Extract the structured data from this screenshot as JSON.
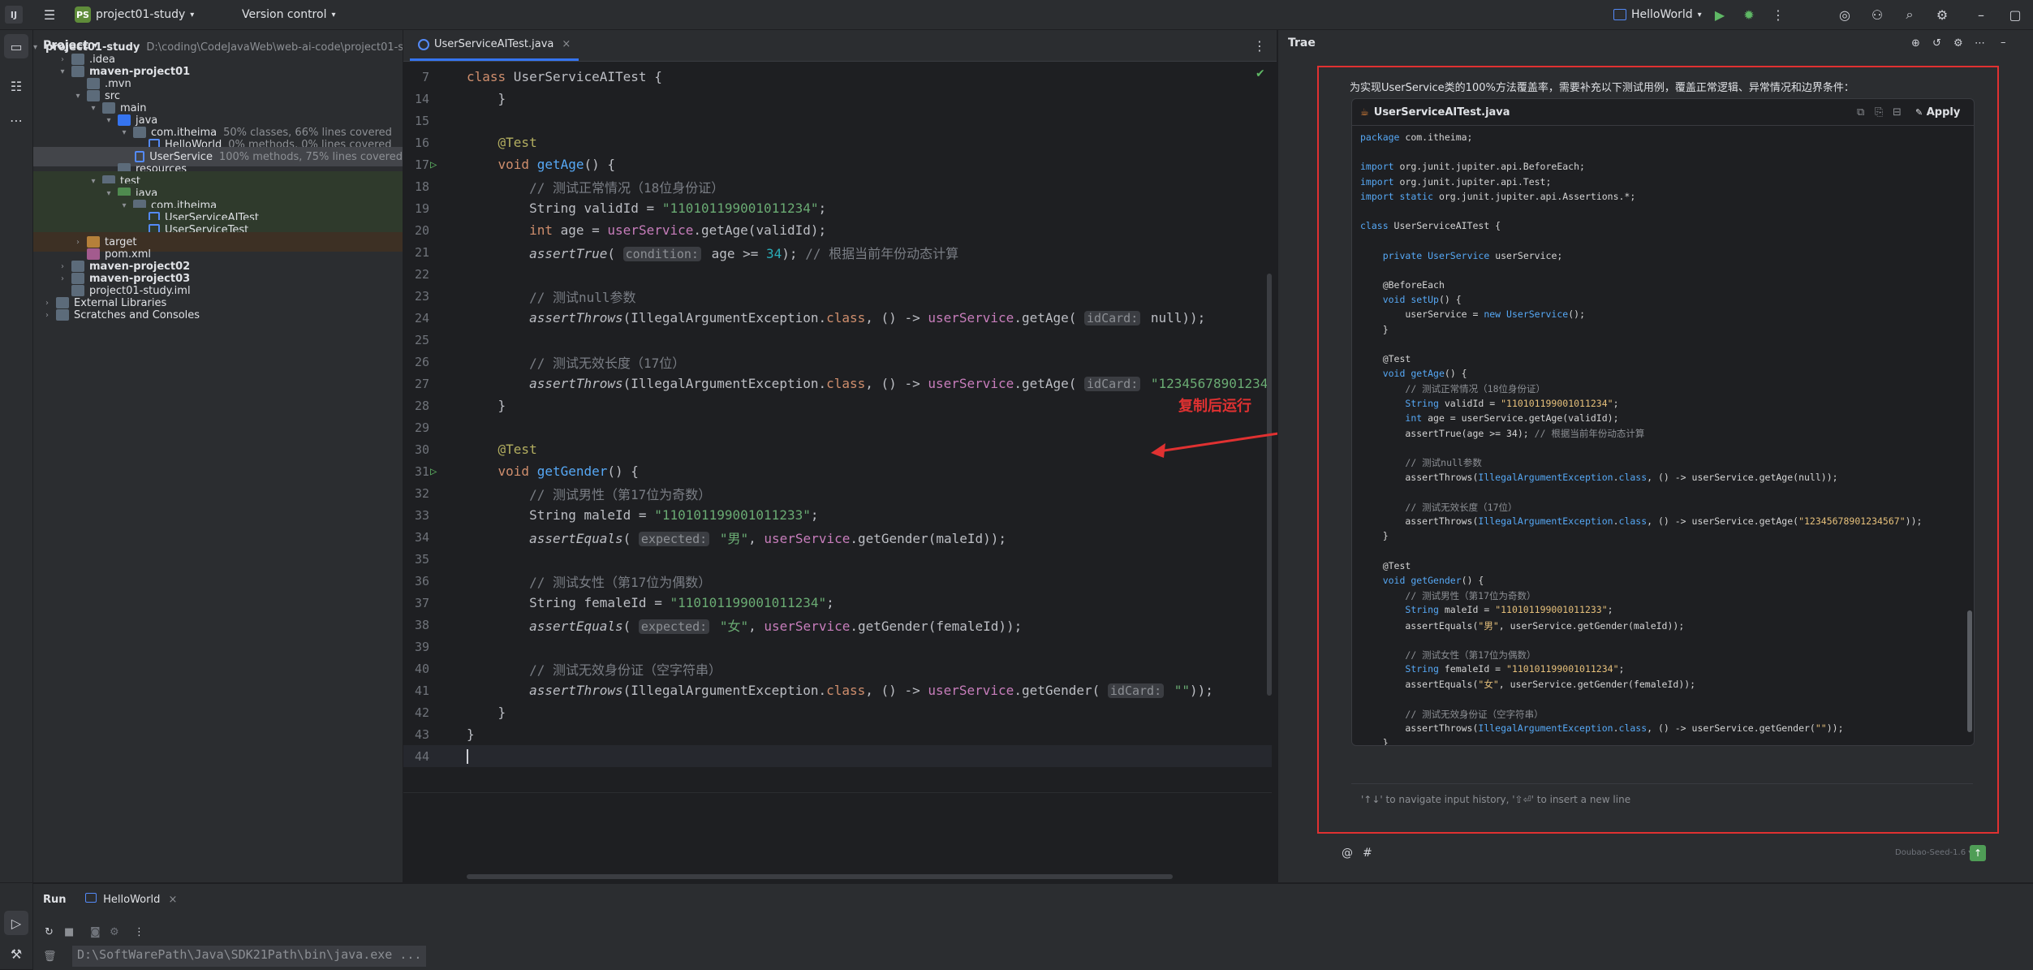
{
  "topbar": {
    "project_badge": "PS",
    "project_name": "project01-study",
    "vcs_label": "Version control",
    "run_config": "HelloWorld"
  },
  "project_panel": {
    "title": "Project",
    "tree": [
      {
        "label": "project01-study",
        "hint": "D:\\coding\\CodeJavaWeb\\web-ai-code\\project01-st",
        "bold": true
      },
      {
        "label": ".idea"
      },
      {
        "label": "maven-project01",
        "bold": true
      },
      {
        "label": ".mvn"
      },
      {
        "label": "src"
      },
      {
        "label": "main"
      },
      {
        "label": "java"
      },
      {
        "label": "com.itheima",
        "hint": "50% classes, 66% lines covered"
      },
      {
        "label": "HelloWorld",
        "hint": "0% methods, 0% lines covered"
      },
      {
        "label": "UserService",
        "hint": "100% methods, 75% lines covered"
      },
      {
        "label": "resources"
      },
      {
        "label": "test"
      },
      {
        "label": "java"
      },
      {
        "label": "com.itheima"
      },
      {
        "label": "UserServiceAITest"
      },
      {
        "label": "UserServiceTest"
      },
      {
        "label": "target"
      },
      {
        "label": "pom.xml"
      },
      {
        "label": "maven-project02",
        "bold": true
      },
      {
        "label": "maven-project03",
        "bold": true
      },
      {
        "label": "project01-study.iml"
      },
      {
        "label": "External Libraries"
      },
      {
        "label": "Scratches and Consoles"
      }
    ]
  },
  "editor": {
    "tab": "UserServiceAITest.java",
    "lines": [
      {
        "n": "7",
        "text": "class UserServiceAITest {"
      },
      {
        "n": "14",
        "text": "    }"
      },
      {
        "n": "15",
        "text": ""
      },
      {
        "n": "16",
        "text": "    @Test"
      },
      {
        "n": "17",
        "text": "    void getAge() {"
      },
      {
        "n": "18",
        "text": "        // 测试正常情况（18位身份证）"
      },
      {
        "n": "19",
        "text": "        String validId = \"110101199001011234\";"
      },
      {
        "n": "20",
        "text": "        int age = userService.getAge(validId);"
      },
      {
        "n": "21",
        "text": "        assertTrue( condition: age >= 34); // 根据当前年份动态计算"
      },
      {
        "n": "22",
        "text": ""
      },
      {
        "n": "23",
        "text": "        // 测试null参数"
      },
      {
        "n": "24",
        "text": "        assertThrows(IllegalArgumentException.class, () -> userService.getAge( idCard: null));"
      },
      {
        "n": "25",
        "text": ""
      },
      {
        "n": "26",
        "text": "        // 测试无效长度（17位）"
      },
      {
        "n": "27",
        "text": "        assertThrows(IllegalArgumentException.class, () -> userService.getAge( idCard: \"12345678901234"
      },
      {
        "n": "28",
        "text": "    }"
      },
      {
        "n": "29",
        "text": ""
      },
      {
        "n": "30",
        "text": "    @Test"
      },
      {
        "n": "31",
        "text": "    void getGender() {"
      },
      {
        "n": "32",
        "text": "        // 测试男性（第17位为奇数）"
      },
      {
        "n": "33",
        "text": "        String maleId = \"110101199001011233\";"
      },
      {
        "n": "34",
        "text": "        assertEquals( expected: \"男\", userService.getGender(maleId));"
      },
      {
        "n": "35",
        "text": ""
      },
      {
        "n": "36",
        "text": "        // 测试女性（第17位为偶数）"
      },
      {
        "n": "37",
        "text": "        String femaleId = \"110101199001011234\";"
      },
      {
        "n": "38",
        "text": "        assertEquals( expected: \"女\", userService.getGender(femaleId));"
      },
      {
        "n": "39",
        "text": ""
      },
      {
        "n": "40",
        "text": "        // 测试无效身份证（空字符串）"
      },
      {
        "n": "41",
        "text": "        assertThrows(IllegalArgumentException.class, () -> userService.getGender( idCard: \"\"));"
      },
      {
        "n": "42",
        "text": "    }"
      },
      {
        "n": "43",
        "text": "}"
      },
      {
        "n": "44",
        "text": ""
      }
    ]
  },
  "trae": {
    "title": "Trae",
    "message": "为实现UserService类的100%方法覆盖率，需要补充以下测试用例，覆盖正常逻辑、异常情况和边界条件：",
    "card_file": "UserServiceAITest.java",
    "apply_label": "Apply",
    "code": [
      "package com.itheima;",
      "",
      "import org.junit.jupiter.api.BeforeEach;",
      "import org.junit.jupiter.api.Test;",
      "import static org.junit.jupiter.api.Assertions.*;",
      "",
      "class UserServiceAITest {",
      "",
      "    private UserService userService;",
      "",
      "    @BeforeEach",
      "    void setUp() {",
      "        userService = new UserService();",
      "    }",
      "",
      "    @Test",
      "    void getAge() {",
      "        // 测试正常情况（18位身份证）",
      "        String validId = \"110101199001011234\";",
      "        int age = userService.getAge(validId);",
      "        assertTrue(age >= 34); // 根据当前年份动态计算",
      "",
      "        // 测试null参数",
      "        assertThrows(IllegalArgumentException.class, () -> userService.getAge(null));",
      "",
      "        // 测试无效长度（17位）",
      "        assertThrows(IllegalArgumentException.class, () -> userService.getAge(\"12345678901234567\"));",
      "    }",
      "",
      "    @Test",
      "    void getGender() {",
      "        // 测试男性（第17位为奇数）",
      "        String maleId = \"110101199001011233\";",
      "        assertEquals(\"男\", userService.getGender(maleId));",
      "",
      "        // 测试女性（第17位为偶数）",
      "        String femaleId = \"110101199001011234\";",
      "        assertEquals(\"女\", userService.getGender(femaleId));",
      "",
      "        // 测试无效身份证（空字符串）",
      "        assertThrows(IllegalArgumentException.class, () -> userService.getGender(\"\"));",
      "    }",
      "}"
    ],
    "input_placeholder": "'↑↓' to navigate input history, '⇧⏎' to insert a new line",
    "model_label": "Doubao-Seed-1.6",
    "at_label": "@",
    "hash_label": "#"
  },
  "annotation": {
    "text": "复制后运行",
    "color": "#e03131"
  },
  "run_panel": {
    "title": "Run",
    "tab": "HelloWorld",
    "console": "D:\\SoftWarePath\\Java\\SDK21Path\\bin\\java.exe ..."
  }
}
